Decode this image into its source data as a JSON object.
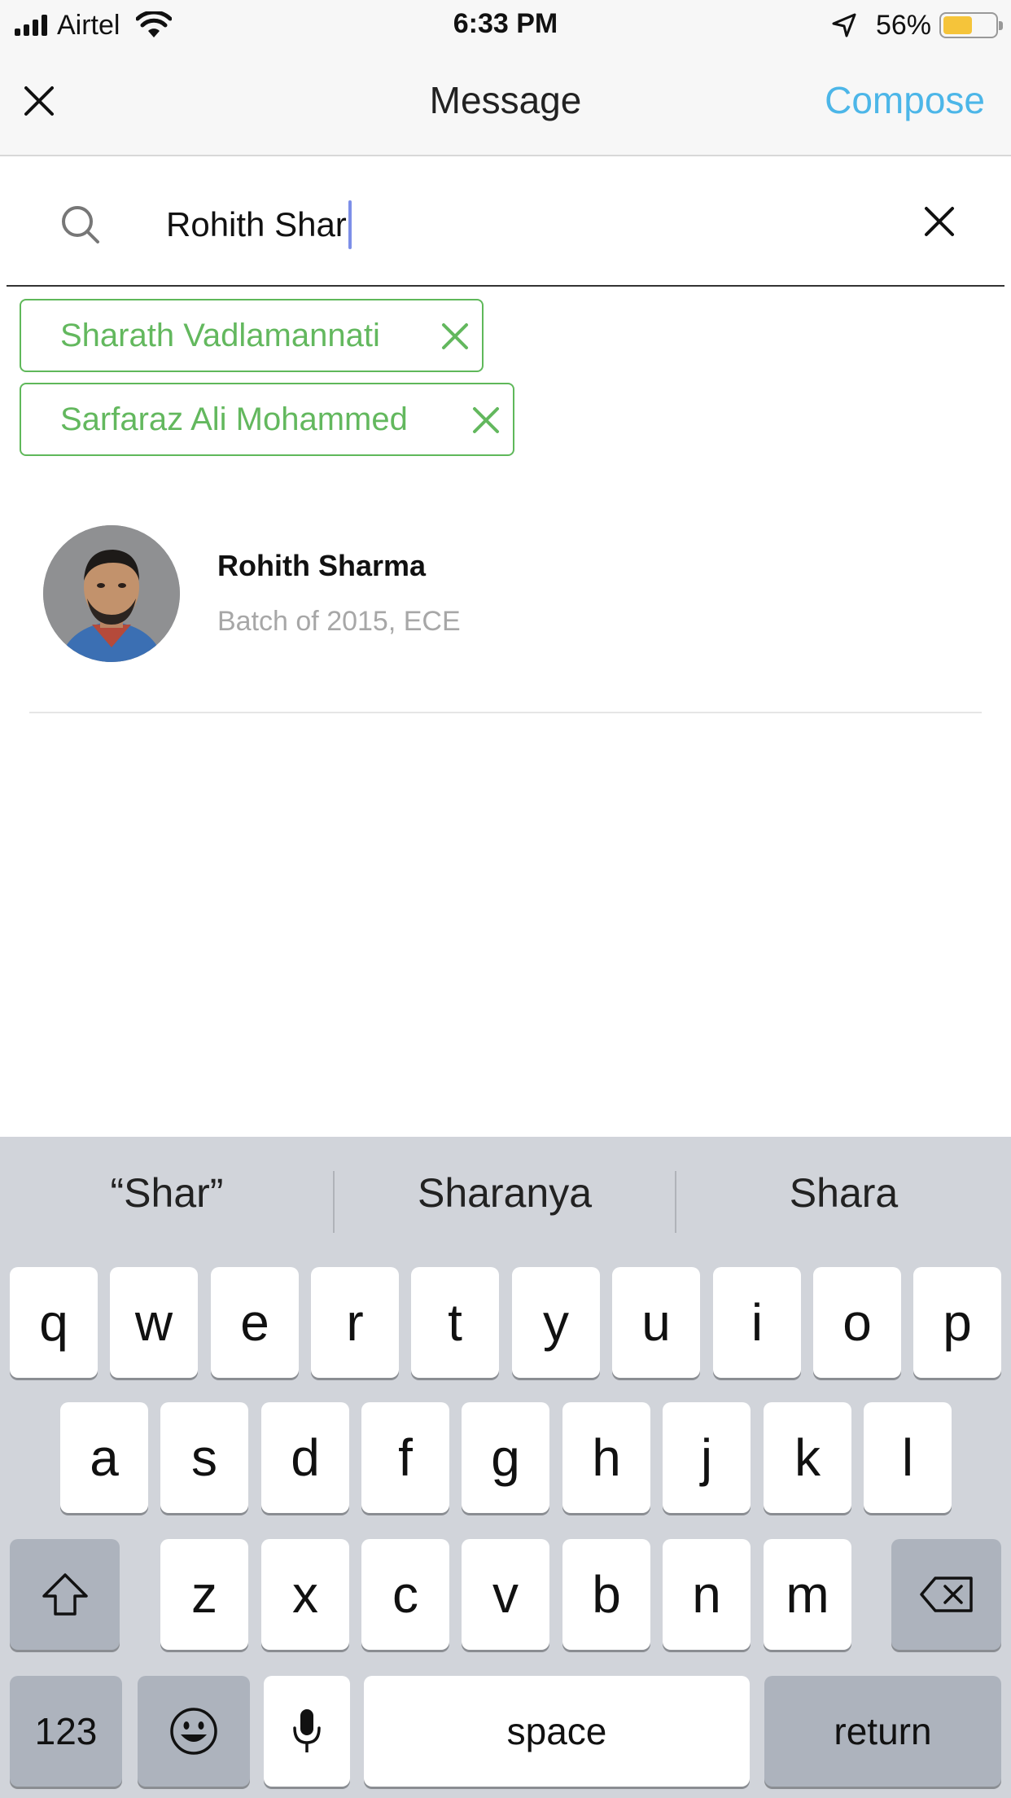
{
  "status_bar": {
    "carrier": "Airtel",
    "time": "6:33 PM",
    "battery": "56%",
    "battery_level": 0.56,
    "icons": [
      "signal-icon",
      "wifi-icon",
      "location-arrow-icon",
      "battery-icon"
    ]
  },
  "nav": {
    "title": "Message",
    "compose_label": "Compose",
    "close_icon": "close-icon",
    "accent_color": "#4cb6e8"
  },
  "search": {
    "value": "Rohith Shar",
    "search_icon": "search-icon",
    "clear_icon": "clear-icon"
  },
  "selected_recipients": [
    {
      "label": "Sharath Vadlamannati"
    },
    {
      "label": "Sarfaraz Ali Mohammed"
    }
  ],
  "chip_color": "#63b85e",
  "results": [
    {
      "name": "Rohith Sharma",
      "subtitle": "Batch of 2015, ECE"
    }
  ],
  "keyboard": {
    "suggestions": [
      "“Shar”",
      "Sharanya",
      "Shara"
    ],
    "row1": [
      "q",
      "w",
      "e",
      "r",
      "t",
      "y",
      "u",
      "i",
      "o",
      "p"
    ],
    "row2": [
      "a",
      "s",
      "d",
      "f",
      "g",
      "h",
      "j",
      "k",
      "l"
    ],
    "row3": [
      "z",
      "x",
      "c",
      "v",
      "b",
      "n",
      "m"
    ],
    "numbers_label": "123",
    "space_label": "space",
    "return_label": "return",
    "icons": [
      "shift-icon",
      "backspace-icon",
      "emoji-icon",
      "microphone-icon"
    ]
  }
}
